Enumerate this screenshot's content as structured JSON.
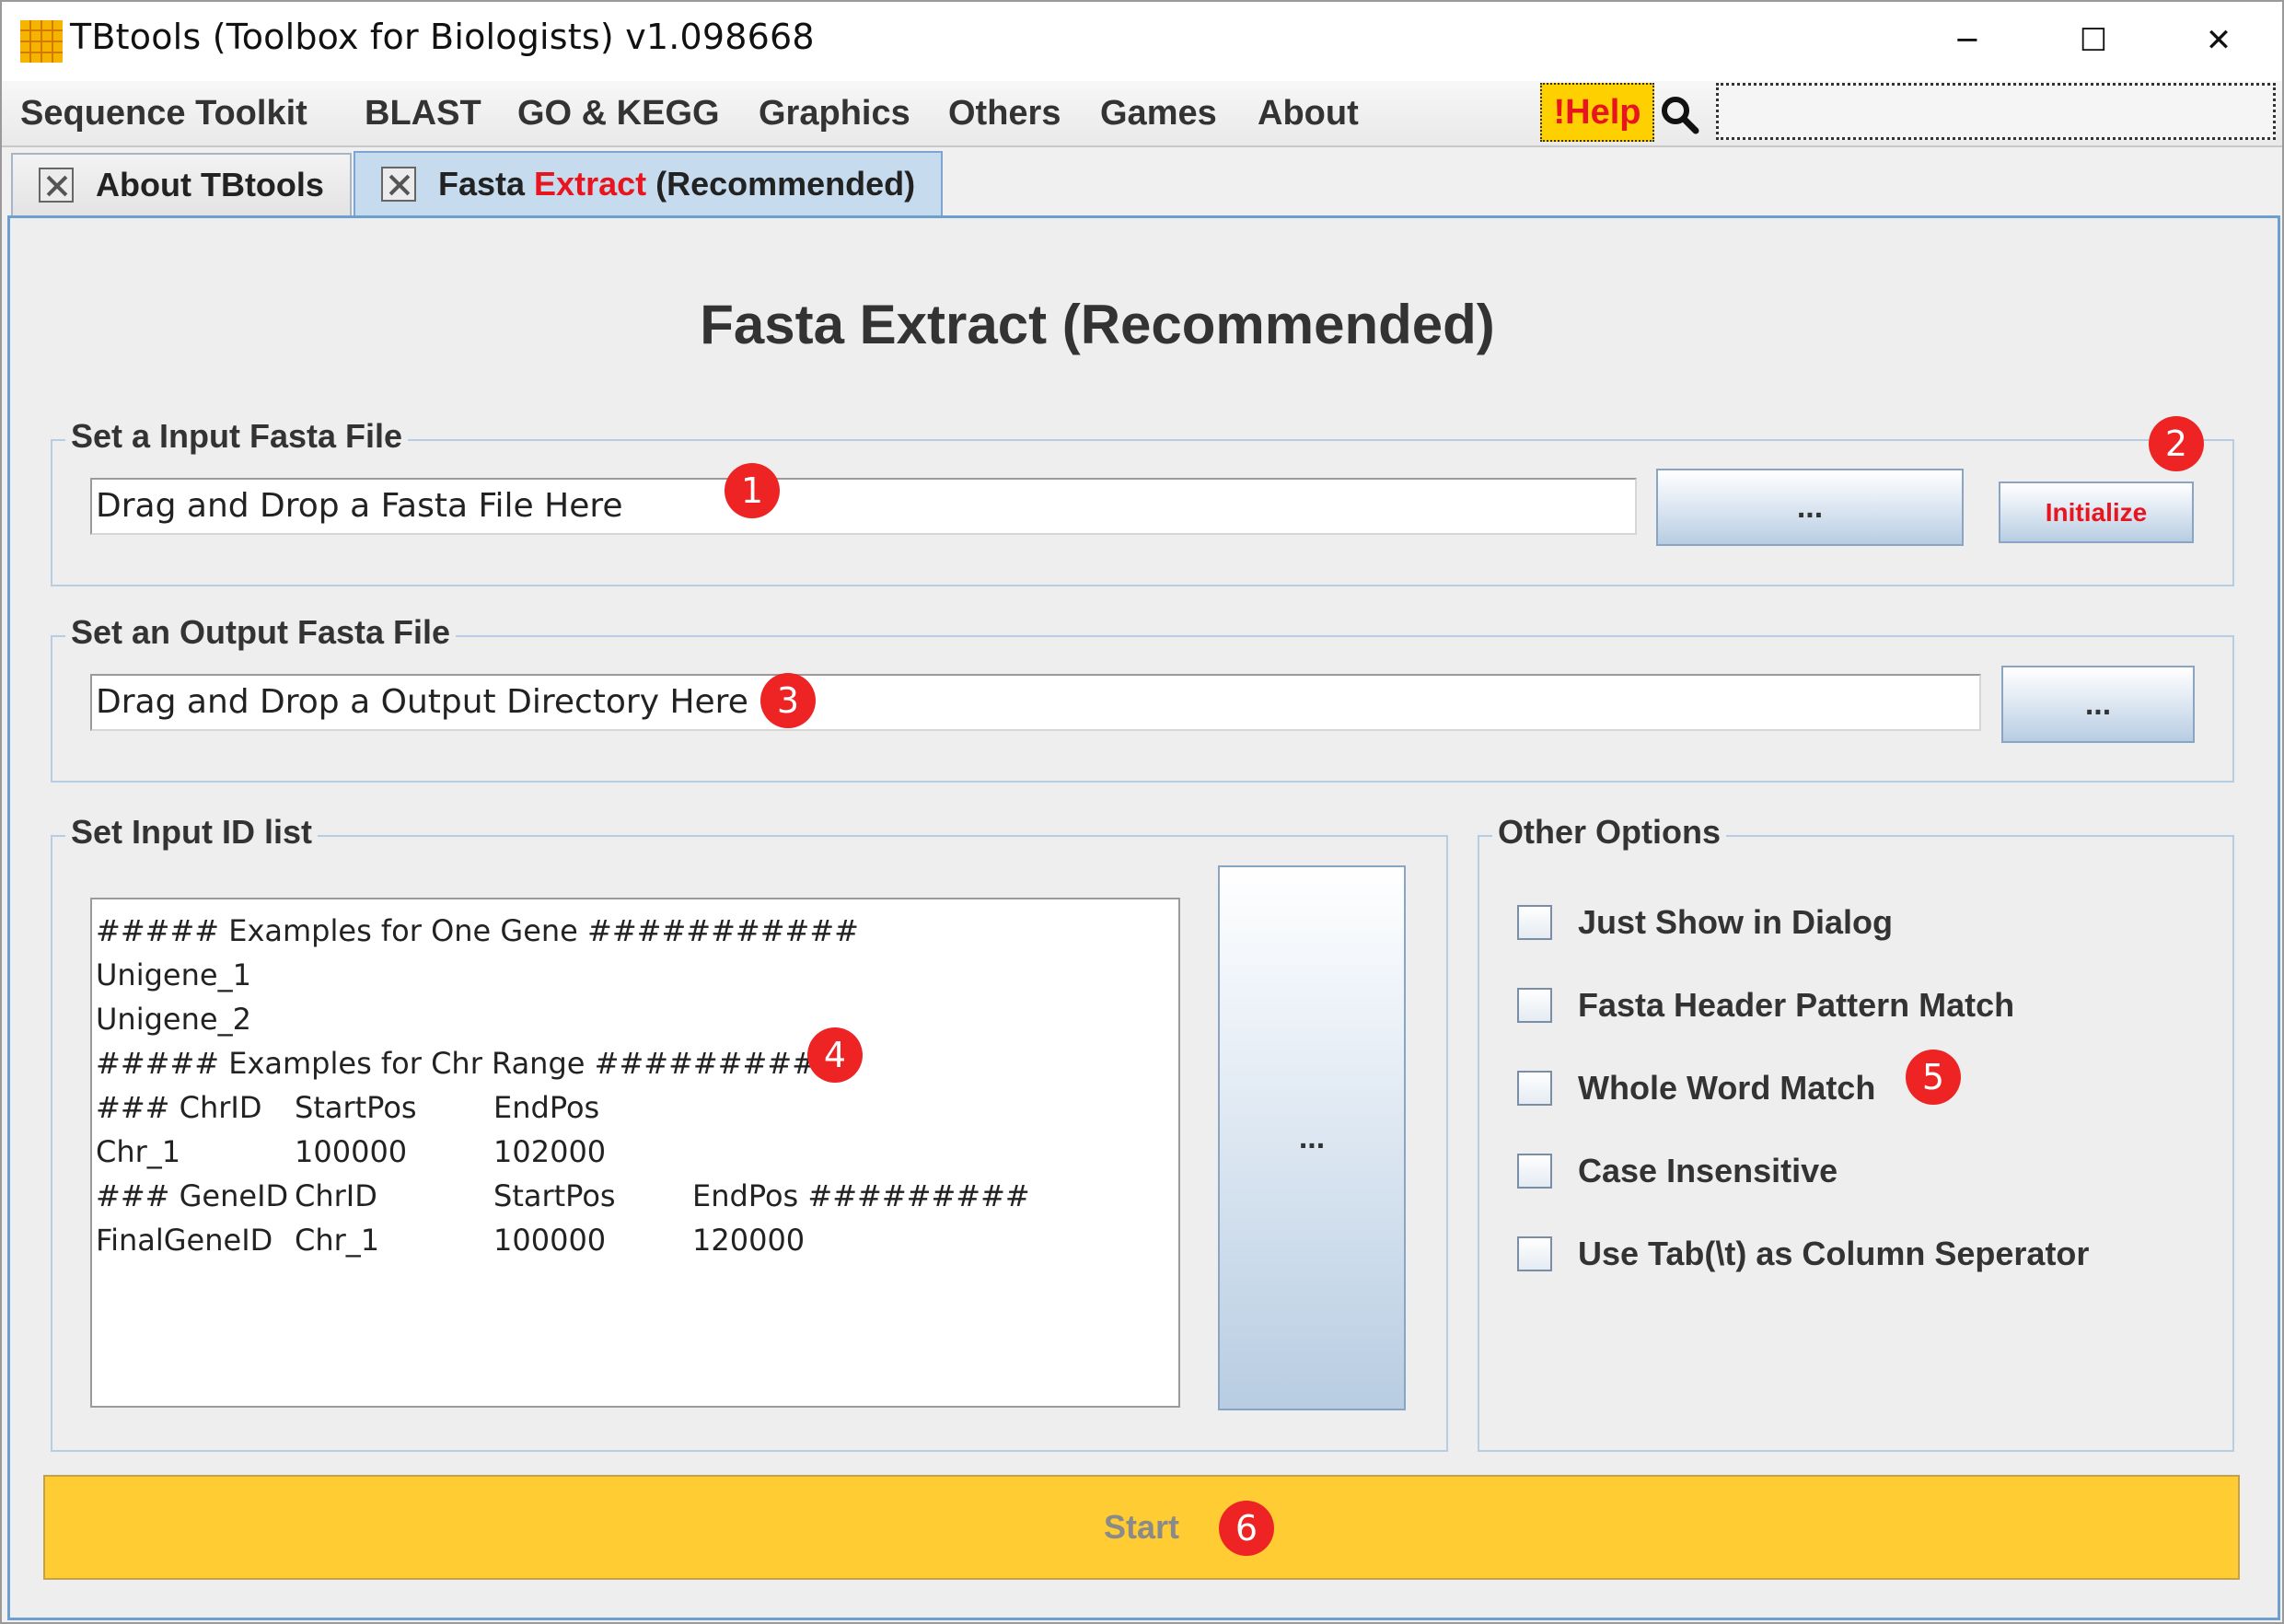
{
  "window": {
    "title": "TBtools (Toolbox for Biologists) v1.098668",
    "controls": {
      "minimize": "─",
      "maximize": "☐",
      "close": "✕"
    }
  },
  "menu": {
    "items": [
      "Sequence Toolkit",
      "BLAST",
      "GO & KEGG",
      "Graphics",
      "Others",
      "Games",
      "About"
    ],
    "help_label": "!Help",
    "search_value": ""
  },
  "tabs": [
    {
      "label": "About TBtools",
      "active": false
    },
    {
      "label_prefix": "Fasta ",
      "label_highlight": "Extract",
      "label_suffix": " (Recommended)",
      "active": true
    }
  ],
  "page": {
    "title": "Fasta Extract (Recommended)",
    "input_group": {
      "title": "Set a Input Fasta File",
      "value": "Drag and Drop a Fasta File Here",
      "browse_label": "...",
      "initialize_label": "Initialize"
    },
    "output_group": {
      "title": "Set an Output Fasta File",
      "value": "Drag and Drop a Output Directory Here",
      "browse_label": "..."
    },
    "id_group": {
      "title": "Set Input ID list",
      "browse_label": "...",
      "lines": [
        [
          "##### Examples for One Gene ###########"
        ],
        [
          "Unigene_1"
        ],
        [
          "Unigene_2"
        ],
        [
          "##### Examples for Chr Range #########"
        ],
        [
          "### ChrID",
          "StartPos",
          "EndPos"
        ],
        [
          "Chr_1",
          "100000",
          "102000"
        ],
        [
          "### GeneID",
          "ChrID",
          "StartPos",
          "EndPos #########"
        ],
        [
          "FinalGeneID",
          "Chr_1",
          "100000",
          "120000"
        ]
      ]
    },
    "options_group": {
      "title": "Other Options",
      "options": [
        {
          "label": "Just Show in Dialog",
          "checked": false
        },
        {
          "label": "Fasta Header Pattern Match",
          "checked": false
        },
        {
          "label": "Whole Word Match",
          "checked": false
        },
        {
          "label": "Case Insensitive",
          "checked": false
        },
        {
          "label": "Use Tab(\\t) as Column Seperator",
          "checked": false
        }
      ]
    },
    "start_label": "Start"
  },
  "badges": [
    "1",
    "2",
    "3",
    "4",
    "5",
    "6"
  ],
  "colors": {
    "accent_red": "#e8141e",
    "help_bg": "#ffd000",
    "start_bg": "#ffcc33",
    "badge_red": "#ee2323",
    "active_tab": "#c7dbee"
  }
}
